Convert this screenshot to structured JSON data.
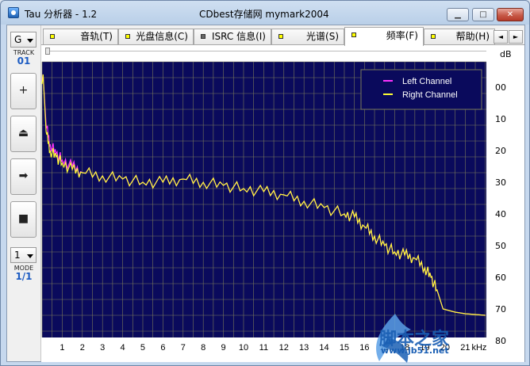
{
  "window": {
    "title": "Tau 分析器 - 1.2",
    "subtitle": "CDbest存储网 mymark2004",
    "controls": {
      "minimize": "▁",
      "maximize": "□",
      "close": "✕"
    }
  },
  "sidebar": {
    "top_select": "G",
    "track_label": "TRACK",
    "track_value": "01",
    "buttons": [
      {
        "name": "add",
        "glyph": "+"
      },
      {
        "name": "eject",
        "glyph": "⏏"
      },
      {
        "name": "next",
        "glyph": "➡"
      },
      {
        "name": "stop",
        "glyph": "■"
      }
    ],
    "bottom_select": "1",
    "mode_label": "MODE",
    "mode_value": "1/1"
  },
  "tabs": [
    {
      "label": "音轨(T)",
      "indicator": "yellow",
      "active": false
    },
    {
      "label": "光盘信息(C)",
      "indicator": "yellow",
      "active": false
    },
    {
      "label": "ISRC 信息(I)",
      "indicator": "gray",
      "active": false
    },
    {
      "label": "光谱(S)",
      "indicator": "yellow",
      "active": false
    },
    {
      "label": "频率(F)",
      "indicator": "yellow",
      "active": true
    },
    {
      "label": "帮助(H)",
      "indicator": "yellow",
      "active": false
    }
  ],
  "tab_scroll": {
    "left": "◄",
    "right": "►"
  },
  "chart_data": {
    "type": "line",
    "xlabel": "kHz",
    "ylabel": "dB",
    "x_ticks": [
      "1",
      "2",
      "3",
      "4",
      "5",
      "6",
      "7",
      "8",
      "9",
      "10",
      "11",
      "12",
      "13",
      "14",
      "15",
      "16",
      "17",
      "18",
      "19",
      "20",
      "21"
    ],
    "y_ticks": [
      "00",
      "10",
      "20",
      "30",
      "40",
      "50",
      "60",
      "70",
      "80"
    ],
    "xlim": [
      0,
      22.05
    ],
    "ylim": [
      0,
      87
    ],
    "grid": true,
    "legend_position": "top-right",
    "colors": {
      "background": "#0a0a5c",
      "grid": "#7a7a5a",
      "left": "#ff33ff",
      "right": "#ffff33"
    },
    "series": [
      {
        "name": "Left Channel",
        "color": "#ff33ff",
        "x": [
          0,
          0.05,
          0.2,
          0.4,
          0.7,
          1.0,
          1.5,
          2.0,
          3.0,
          4.0,
          5.0,
          6.0,
          7.0,
          8.0,
          9.0,
          10.0,
          11.0,
          12.0,
          13.0,
          14.0,
          15.0,
          15.5,
          16.0,
          16.5,
          17.0,
          17.5,
          18.0,
          18.5,
          19.0,
          19.3,
          19.6,
          19.9,
          20.5,
          21.0,
          22.0
        ],
        "y": [
          6,
          4,
          20,
          26,
          29,
          31,
          33,
          35,
          36,
          37,
          38,
          38,
          37,
          38,
          39,
          40,
          41,
          42,
          44,
          46,
          48,
          49,
          52,
          55,
          58,
          60,
          61,
          62,
          65,
          68,
          72,
          78,
          79,
          79.5,
          80
        ]
      },
      {
        "name": "Right Channel",
        "color": "#ffff33",
        "x": [
          0,
          0.05,
          0.2,
          0.4,
          0.7,
          1.0,
          1.5,
          2.0,
          3.0,
          4.0,
          5.0,
          6.0,
          7.0,
          8.0,
          9.0,
          10.0,
          11.0,
          12.0,
          13.0,
          14.0,
          15.0,
          15.5,
          16.0,
          16.5,
          17.0,
          17.5,
          18.0,
          18.5,
          19.0,
          19.3,
          19.6,
          19.9,
          20.5,
          21.0,
          22.0
        ],
        "y": [
          7,
          4,
          22,
          28,
          30,
          32,
          34,
          35,
          36,
          37,
          38,
          38,
          37,
          38,
          39,
          40,
          41,
          42,
          44,
          46,
          48,
          49,
          52,
          55,
          58,
          60,
          61,
          62,
          65,
          68,
          72,
          78,
          79,
          79.5,
          80
        ]
      }
    ]
  },
  "watermark": {
    "text": "脚本之家",
    "url": "www.jb51.net"
  }
}
